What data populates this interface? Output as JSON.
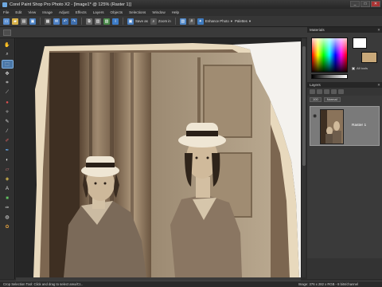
{
  "window": {
    "title": "Corel Paint Shop Pro Photo X2 - [Image1* @ 125% (Raster 1)]",
    "controls": [
      "_",
      "□",
      "✕"
    ]
  },
  "menu": [
    "File",
    "Edit",
    "View",
    "Image",
    "Adjust",
    "Effects",
    "Layers",
    "Objects",
    "Selections",
    "Window",
    "Help"
  ],
  "toolbar": {
    "save_as_label": "Save as",
    "zoom_label": "Zoom in",
    "enhance_label": "Enhance Photo",
    "palettes_label": "Palettes"
  },
  "palettes": {
    "materials_title": "Materials",
    "all_tools_label": "All tools",
    "fg_color": "#ffffff",
    "bg_color": "#c8a879",
    "layers_title": "Layers",
    "layer_opacity_label": "100",
    "layer_blend_label": "Normal",
    "layer_name": "Raster 1"
  },
  "status": {
    "help_text": "Crop Selection Tool: Click and drag to select area/Cr...",
    "image_info": "Image: 376 x 282 x RGB - 8 bits/channel"
  },
  "colors": {
    "accent": "#4b78a8",
    "photo_sepia": "#8a735a"
  }
}
